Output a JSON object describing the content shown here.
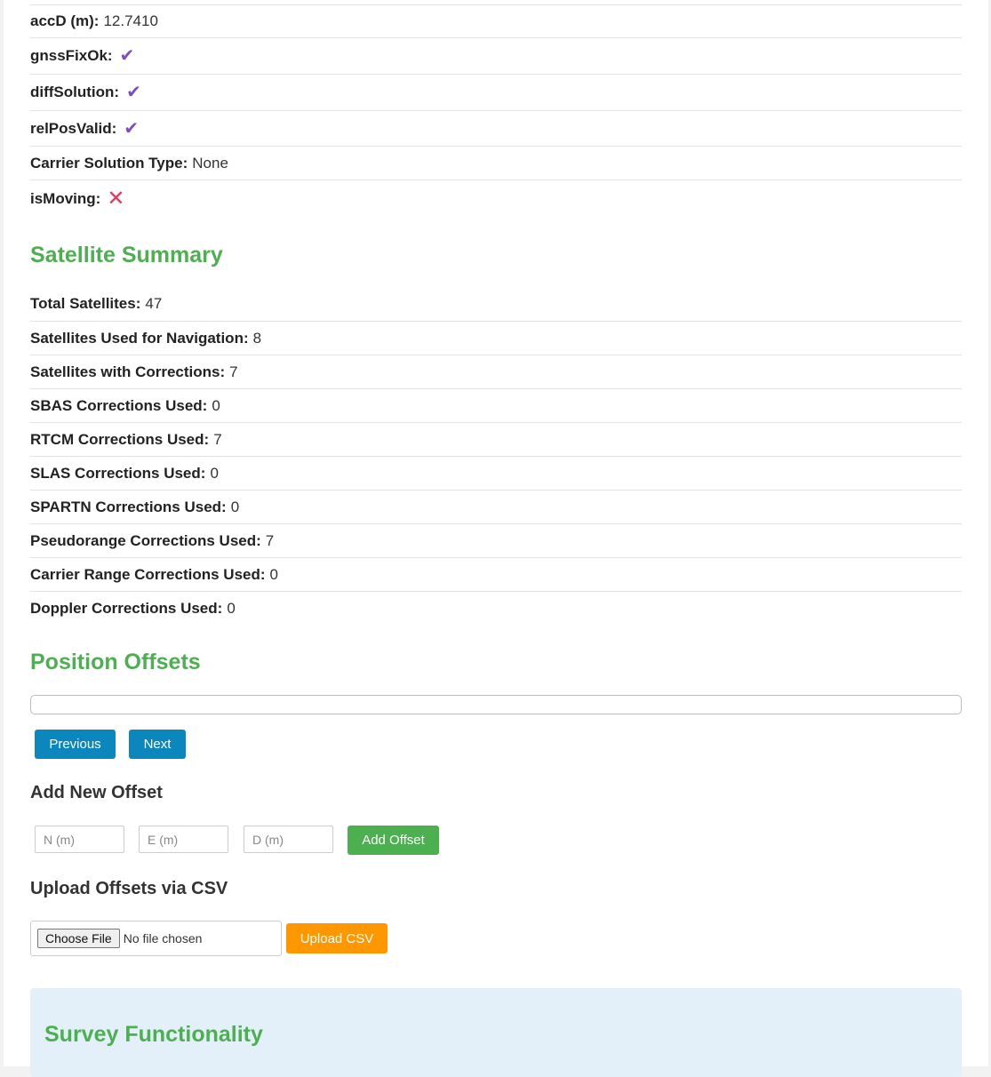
{
  "status": {
    "accd": {
      "label": "accD (m):",
      "value": "12.7410"
    },
    "gnss_fix_ok": {
      "label": "gnssFixOk:",
      "icon": "check-icon",
      "mark": "✔"
    },
    "diff_solution": {
      "label": "diffSolution:",
      "icon": "check-icon",
      "mark": "✔"
    },
    "rel_pos_valid": {
      "label": "relPosValid:",
      "icon": "check-icon",
      "mark": "✔"
    },
    "carrier_solution": {
      "label": "Carrier Solution Type:",
      "value": "None"
    },
    "is_moving": {
      "label": "isMoving:",
      "icon": "cross-icon",
      "mark": "✕"
    }
  },
  "satellite_summary": {
    "title": "Satellite Summary",
    "items": [
      {
        "label": "Total Satellites:",
        "value": "47"
      },
      {
        "label": "Satellites Used for Navigation:",
        "value": "8"
      },
      {
        "label": "Satellites with Corrections:",
        "value": "7"
      },
      {
        "label": "SBAS Corrections Used:",
        "value": "0"
      },
      {
        "label": "RTCM Corrections Used:",
        "value": "7"
      },
      {
        "label": "SLAS Corrections Used:",
        "value": "0"
      },
      {
        "label": "SPARTN Corrections Used:",
        "value": "0"
      },
      {
        "label": "Pseudorange Corrections Used:",
        "value": "7"
      },
      {
        "label": "Carrier Range Corrections Used:",
        "value": "0"
      },
      {
        "label": "Doppler Corrections Used:",
        "value": "0"
      }
    ]
  },
  "position_offsets": {
    "title": "Position Offsets",
    "previous_label": "Previous",
    "next_label": "Next",
    "add_title": "Add New Offset",
    "n_placeholder": "N (m)",
    "e_placeholder": "E (m)",
    "d_placeholder": "D (m)",
    "add_button": "Add Offset",
    "upload_title": "Upload Offsets via CSV",
    "choose_file": "Choose File",
    "no_file": "No file chosen",
    "upload_button": "Upload CSV"
  },
  "survey": {
    "title": "Survey Functionality"
  },
  "colors": {
    "accent_green": "#4caf50",
    "button_blue": "#0b87bd",
    "button_orange": "#ff9800",
    "check_purple": "#7b4fc2",
    "cross_red": "#e8355d"
  }
}
